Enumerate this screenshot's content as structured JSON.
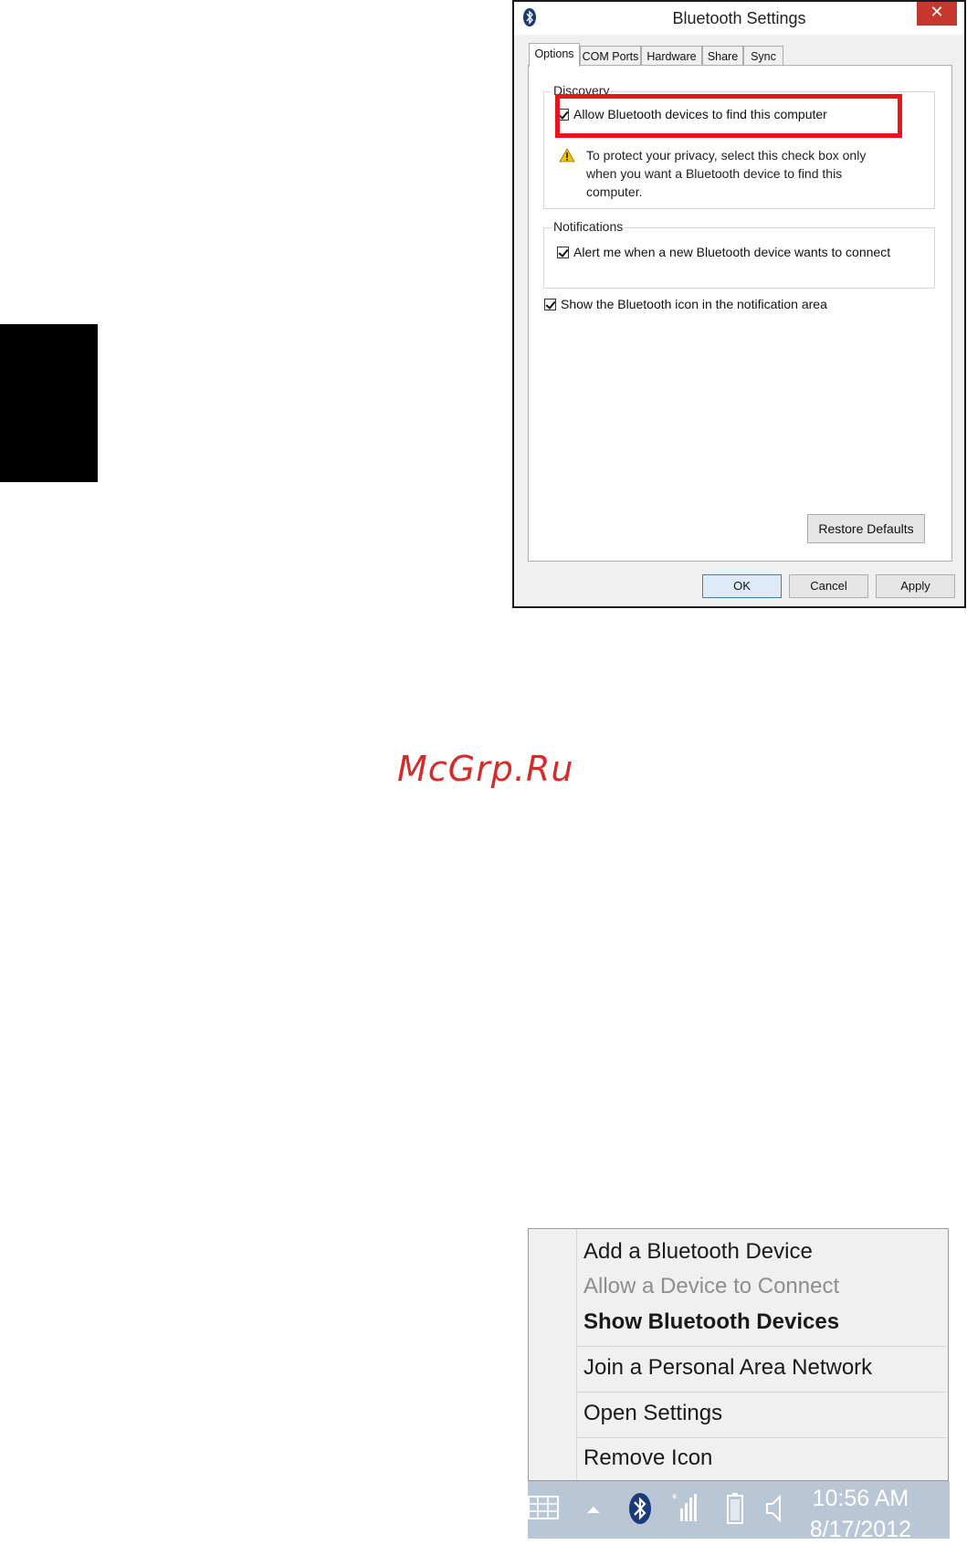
{
  "dialog": {
    "title": "Bluetooth Settings",
    "close_label": "✕",
    "tabs": [
      "Options",
      "COM Ports",
      "Hardware",
      "Share",
      "Sync"
    ],
    "discovery": {
      "group_label": "Discovery",
      "allow_label": "Allow Bluetooth devices to find this computer",
      "allow_checked": true,
      "warning_text": "To protect your privacy, select this check box only when you want a Bluetooth device to find this computer."
    },
    "notifications": {
      "group_label": "Notifications",
      "alert_label": "Alert me when a new Bluetooth device wants to connect",
      "alert_checked": true
    },
    "show_icon_label": "Show the Bluetooth icon in the notification area",
    "show_icon_checked": true,
    "restore_label": "Restore Defaults",
    "ok_label": "OK",
    "cancel_label": "Cancel",
    "apply_label": "Apply"
  },
  "watermark": "McGrp.Ru",
  "context_menu": {
    "items": [
      "Add a Bluetooth Device",
      "Allow a Device to Connect",
      "Show Bluetooth Devices",
      "Join a Personal Area Network",
      "Open Settings",
      "Remove Icon"
    ]
  },
  "taskbar": {
    "time": "10:56 AM",
    "date": "8/17/2012"
  },
  "colors": {
    "highlight": "#e8161c",
    "close_button": "#c7372f",
    "taskbar": "#b8c6d6",
    "watermark": "#d42b2b"
  }
}
